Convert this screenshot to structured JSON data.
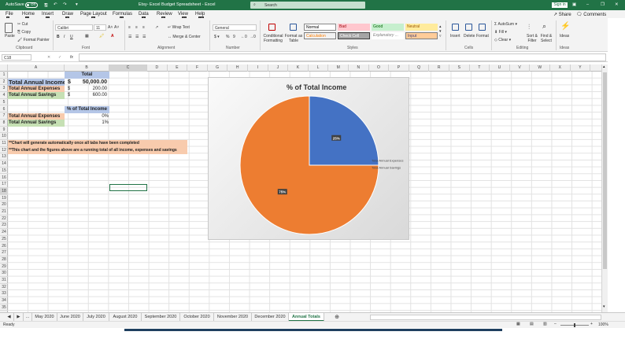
{
  "titlebar": {
    "autosave_label": "AutoSave",
    "autosave_state": "Off",
    "doc_title": "Etsy- Excel Budget Spreadsheet  -  Excel",
    "search_placeholder": "Search",
    "signin_label": "Sign in"
  },
  "menu": [
    "File",
    "Home",
    "Insert",
    "Draw",
    "Page Layout",
    "Formulas",
    "Data",
    "Review",
    "View",
    "Help"
  ],
  "menu_keys": [
    "F",
    "H",
    "N",
    "JI",
    "P",
    "M",
    "A",
    "R",
    "W",
    "Y2"
  ],
  "share_label": "Share",
  "comments_label": "Comments",
  "ribbon": {
    "clipboard": {
      "paste": "Paste",
      "cut": "Cut",
      "copy": "Copy",
      "format_painter": "Format Painter",
      "group": "Clipboard"
    },
    "font": {
      "name": "Calibri",
      "size": "11",
      "group": "Font"
    },
    "alignment": {
      "wrap": "Wrap Text",
      "merge": "Merge & Center",
      "group": "Alignment"
    },
    "number": {
      "format": "General",
      "group": "Number"
    },
    "styles": {
      "conditional": "Conditional Formatting",
      "format_table": "Format as Table",
      "items": [
        {
          "label": "Normal",
          "bg": "#ffffff",
          "fg": "#000000"
        },
        {
          "label": "Bad",
          "bg": "#ffc7ce",
          "fg": "#9c0006"
        },
        {
          "label": "Good",
          "bg": "#c6efce",
          "fg": "#006100"
        },
        {
          "label": "Neutral",
          "bg": "#ffeb9c",
          "fg": "#9c5700"
        },
        {
          "label": "Calculation",
          "bg": "#f2f2f2",
          "fg": "#fa7d00"
        },
        {
          "label": "Check Cell",
          "bg": "#a5a5a5",
          "fg": "#ffffff"
        },
        {
          "label": "Explanatory ...",
          "bg": "#ffffff",
          "fg": "#7f7f7f"
        },
        {
          "label": "Input",
          "bg": "#ffcc99",
          "fg": "#3f3f76"
        }
      ],
      "group": "Styles"
    },
    "cells": {
      "insert": "Insert",
      "delete": "Delete",
      "format": "Format",
      "group": "Cells"
    },
    "editing": {
      "autosum": "AutoSum",
      "fill": "Fill",
      "clear": "Clear",
      "sort": "Sort & Filter",
      "find": "Find & Select",
      "group": "Editing"
    },
    "ideas": {
      "label": "Ideas",
      "group": "Ideas"
    }
  },
  "formula_bar": {
    "name_box": "C18",
    "fx": "fx",
    "content": ""
  },
  "columns": [
    "A",
    "B",
    "C",
    "D",
    "E",
    "F",
    "G",
    "H",
    "I",
    "J",
    "K",
    "L",
    "M",
    "N",
    "O",
    "P",
    "Q",
    "R",
    "S",
    "T",
    "U",
    "V",
    "W",
    "X",
    "Y"
  ],
  "rows": [
    "1",
    "2",
    "3",
    "4",
    "5",
    "6",
    "7",
    "8",
    "9",
    "10",
    "11",
    "12",
    "13",
    "14",
    "15",
    "16",
    "17",
    "18",
    "19",
    "20",
    "21",
    "22",
    "23",
    "24",
    "25",
    "26",
    "27",
    "28",
    "29",
    "30",
    "31",
    "32",
    "33",
    "34",
    "35"
  ],
  "sheet": {
    "b1": "Total",
    "a2": "Total Annual Income",
    "b2_cur": "$",
    "b2": "50,000.00",
    "a3": "Total Annual Expenses",
    "b3_cur": "$",
    "b3": "200.00",
    "a4": "Total Annual Savings",
    "b4_cur": "$",
    "b4": "600.00",
    "b6": "% of Total Income",
    "a7": "Total Annual Expenses",
    "b7": "0%",
    "a8": "Total Annual Savings",
    "b8": "1%",
    "a11": "**Chart will generate automatically once all tabs have been completed",
    "a12": "**This chart and the figures above are a running total of all income, expenses and savings"
  },
  "chart_data": {
    "type": "pie",
    "title": "% of Total Income",
    "categories": [
      "Total Annual Expenses",
      "Total Annual Savings"
    ],
    "values": [
      25,
      75
    ],
    "data_labels": [
      "25%",
      "75%"
    ],
    "colors": [
      "#4472c4",
      "#ed7d31"
    ],
    "legend": "right"
  },
  "tabs": [
    "May 2020",
    "June 2020",
    "July 2020",
    "August 2020",
    "September 2020",
    "October 2020",
    "November 2020",
    "December 2020",
    "Annual Totals"
  ],
  "status": {
    "ready": "Ready",
    "zoom": "100%"
  }
}
